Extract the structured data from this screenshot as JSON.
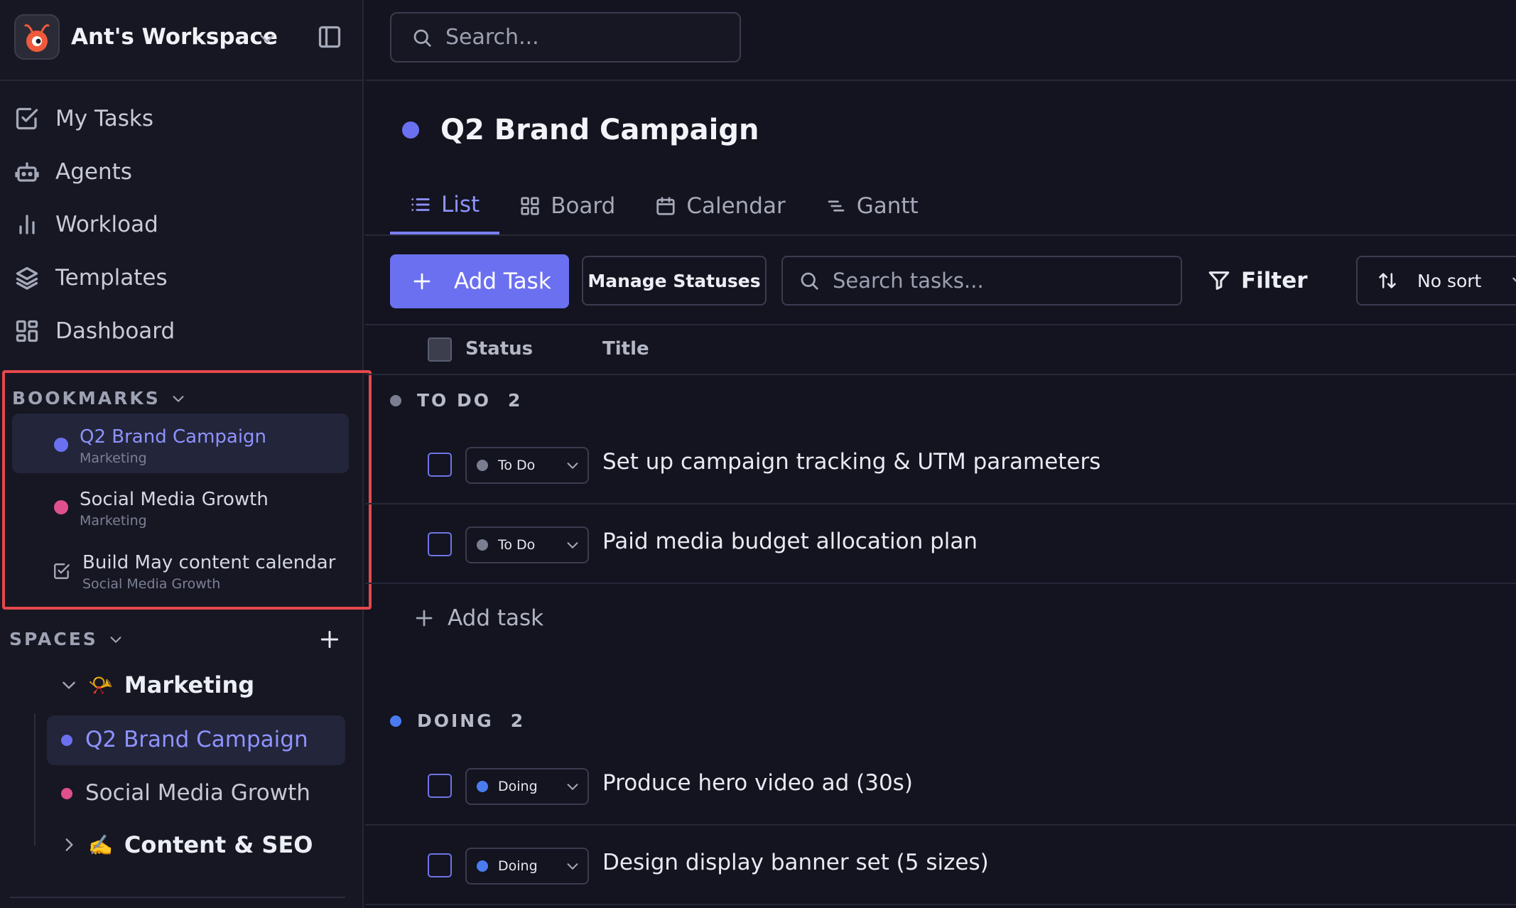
{
  "workspace": {
    "name": "Ant's Workspace"
  },
  "nav": [
    {
      "label": "My Tasks",
      "icon": "check-square-icon"
    },
    {
      "label": "Agents",
      "icon": "robot-icon"
    },
    {
      "label": "Workload",
      "icon": "bar-chart-icon"
    },
    {
      "label": "Templates",
      "icon": "layers-icon"
    },
    {
      "label": "Dashboard",
      "icon": "dashboard-grid-icon"
    }
  ],
  "bookmarks": {
    "title": "BOOKMARKS",
    "items": [
      {
        "title": "Q2 Brand Campaign",
        "subtitle": "Marketing",
        "color": "#6b70f0",
        "kind": "project"
      },
      {
        "title": "Social Media Growth",
        "subtitle": "Marketing",
        "color": "#e0508f",
        "kind": "project"
      },
      {
        "title": "Build May content calendar",
        "subtitle": "Social Media Growth",
        "kind": "task"
      }
    ]
  },
  "spaces": {
    "title": "SPACES",
    "items": [
      {
        "name": "Marketing",
        "emoji": "📯",
        "expanded": true,
        "projects": [
          {
            "label": "Q2 Brand Campaign",
            "color": "#6b70f0"
          },
          {
            "label": "Social Media Growth",
            "color": "#e0508f"
          }
        ]
      },
      {
        "name": "Content & SEO",
        "emoji": "✍️",
        "expanded": false
      }
    ]
  },
  "search": {
    "placeholder": "Search..."
  },
  "project": {
    "title": "Q2 Brand Campaign",
    "color": "#6b70f0"
  },
  "tabs": [
    {
      "label": "List",
      "active": true
    },
    {
      "label": "Board"
    },
    {
      "label": "Calendar"
    },
    {
      "label": "Gantt"
    }
  ],
  "toolbar": {
    "add_task": "Add Task",
    "manage_statuses": "Manage Statuses",
    "search_placeholder": "Search tasks...",
    "filter": "Filter",
    "sort": "No sort"
  },
  "table": {
    "columns": [
      "Status",
      "Title"
    ]
  },
  "groups": [
    {
      "name": "TO DO",
      "count": "2",
      "color": "#7a7e90",
      "tasks": [
        {
          "status": "To Do",
          "title": "Set up campaign tracking & UTM parameters"
        },
        {
          "status": "To Do",
          "title": "Paid media budget allocation plan"
        }
      ],
      "add_task": "Add task"
    },
    {
      "name": "DOING",
      "count": "2",
      "color": "#4a7cf0",
      "tasks": [
        {
          "status": "Doing",
          "title": "Produce hero video ad (30s)"
        },
        {
          "status": "Doing",
          "title": "Design display banner set (5 sizes)"
        }
      ]
    }
  ],
  "colors": {
    "accent": "#6b70f0",
    "highlight_border": "#e5484d",
    "background": "#13141f"
  }
}
